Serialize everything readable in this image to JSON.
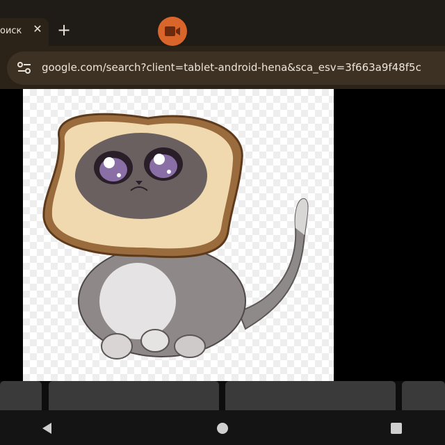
{
  "tab": {
    "title": "оиск",
    "close_symbol": "✕"
  },
  "new_tab_symbol": "+",
  "colors": {
    "accent": "#d9652b",
    "tab_bg": "#2c2318",
    "omnibox_bg": "#3d3124"
  },
  "omnibox": {
    "url": "google.com/search?client=tablet-android-hena&sca_esv=3f663a9f48f5c"
  },
  "icons": {
    "recording": "video-camera-icon",
    "site_info": "tune-icon",
    "back": "back-triangle-icon",
    "home": "home-circle-icon",
    "recents": "recents-square-icon"
  }
}
